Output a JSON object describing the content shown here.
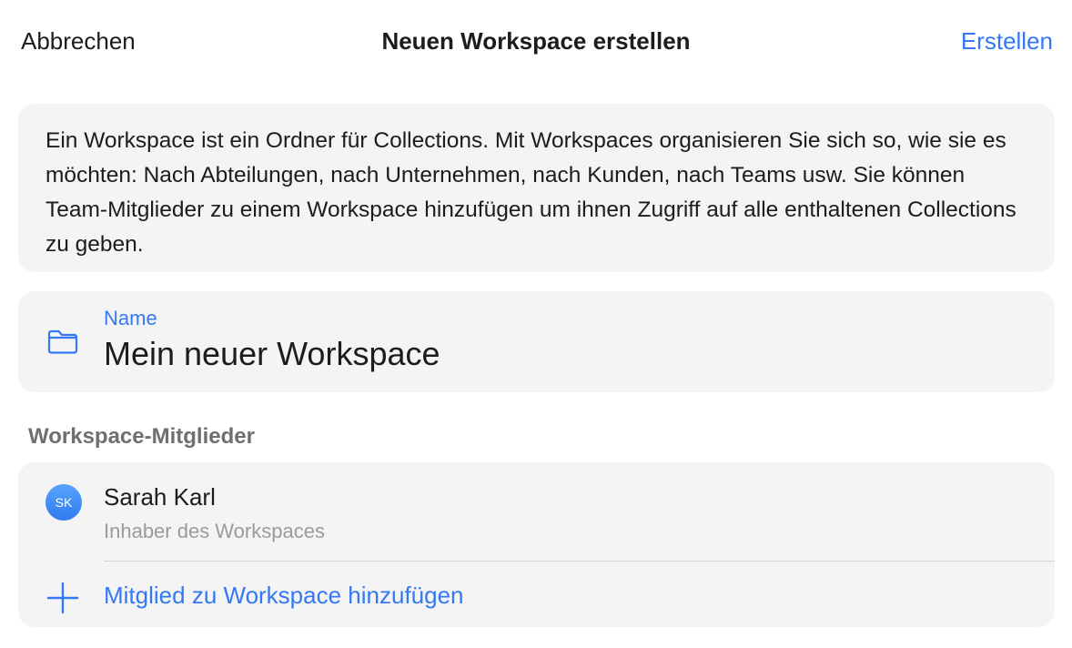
{
  "nav": {
    "cancel_label": "Abbrechen",
    "title": "Neuen Workspace erstellen",
    "create_label": "Erstellen"
  },
  "info": {
    "text": "Ein Workspace ist ein Ordner für Collections. Mit Workspaces organisieren Sie sich so, wie sie es möchten: Nach Abteilungen, nach Unternehmen, nach Kunden, nach Teams usw. Sie können Team-Mitglieder zu einem Workspace hinzufügen um ihnen Zugriff auf alle enthaltenen Collections zu geben."
  },
  "name_field": {
    "icon": "folder-icon",
    "label": "Name",
    "value": "Mein neuer Workspace"
  },
  "members": {
    "section_title": "Workspace-Mitglieder",
    "items": [
      {
        "initials": "SK",
        "name": "Sarah Karl",
        "role": "Inhaber des Workspaces"
      }
    ],
    "add_icon": "plus-icon",
    "add_label": "Mitglied zu Workspace hinzufügen"
  },
  "colors": {
    "accent": "#3478f6",
    "card_background": "#f4f4f5",
    "secondary_text": "#9a9a9f",
    "section_header": "#6e6e73"
  }
}
